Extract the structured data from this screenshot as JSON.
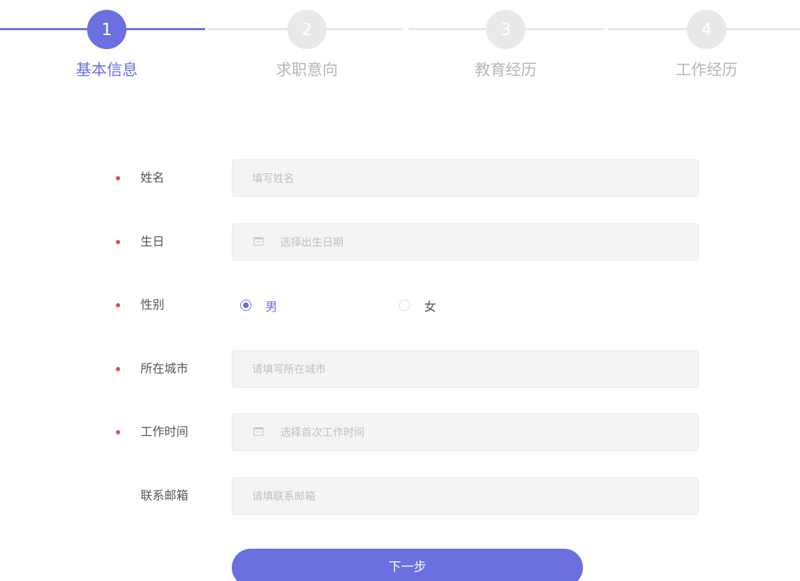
{
  "colors": {
    "accent": "#6a70e0",
    "inactive": "#e9e9e9",
    "required": "#e94a4a"
  },
  "stepper": {
    "current": 1,
    "steps": [
      {
        "number": "1",
        "label": "基本信息"
      },
      {
        "number": "2",
        "label": "求职意向"
      },
      {
        "number": "3",
        "label": "教育经历"
      },
      {
        "number": "4",
        "label": "工作经历"
      }
    ]
  },
  "form": {
    "name": {
      "label": "姓名",
      "placeholder": "填写姓名",
      "required": true
    },
    "birthday": {
      "label": "生日",
      "placeholder": "选择出生日期",
      "required": true,
      "icon": "calendar-icon"
    },
    "gender": {
      "label": "性别",
      "required": true,
      "options": [
        {
          "label": "男",
          "selected": true
        },
        {
          "label": "女",
          "selected": false
        }
      ]
    },
    "city": {
      "label": "所在城市",
      "placeholder": "请填写所在城市",
      "required": true
    },
    "work_time": {
      "label": "工作时间",
      "placeholder": "选择首次工作时间",
      "required": true,
      "icon": "calendar-icon"
    },
    "email": {
      "label": "联系邮箱",
      "placeholder": "请填联系邮箱",
      "required": false
    }
  },
  "next_button": {
    "label": "下一步"
  }
}
